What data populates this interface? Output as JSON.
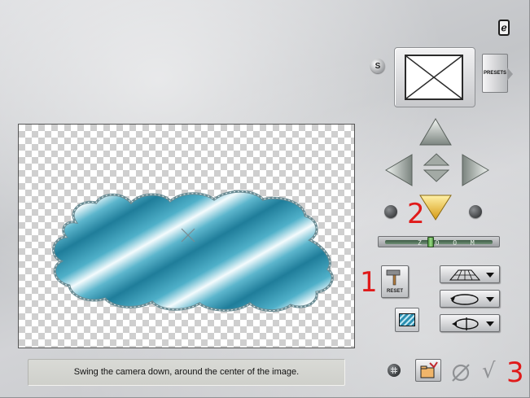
{
  "window": {
    "info_icon_glyph": "ℯ"
  },
  "preview": {
    "crosshair_icon": "crosshair-x-icon"
  },
  "header": {
    "save_button_label": "S",
    "presets_label": "PRESETS"
  },
  "navigation": {
    "up_icon": "arrow-up-icon",
    "down_icon": "arrow-down-icon",
    "left_icon": "arrow-left-icon",
    "right_icon": "arrow-right-icon",
    "active": "down"
  },
  "zoom": {
    "label": "Z O O M",
    "level": 0.42
  },
  "tools": {
    "reset_label": "RESET",
    "mode_icons": [
      "perspective-grid-icon",
      "rotate-icon",
      "spin-icon"
    ]
  },
  "status": {
    "message": "Swing the camera down, around the center of the image."
  },
  "annotations": {
    "marks": [
      "1",
      "2",
      "3"
    ]
  },
  "colors": {
    "accent": "#e01a1a",
    "arrow_active": "#f0c22d",
    "arrow_idle": "#b7bdb8"
  }
}
